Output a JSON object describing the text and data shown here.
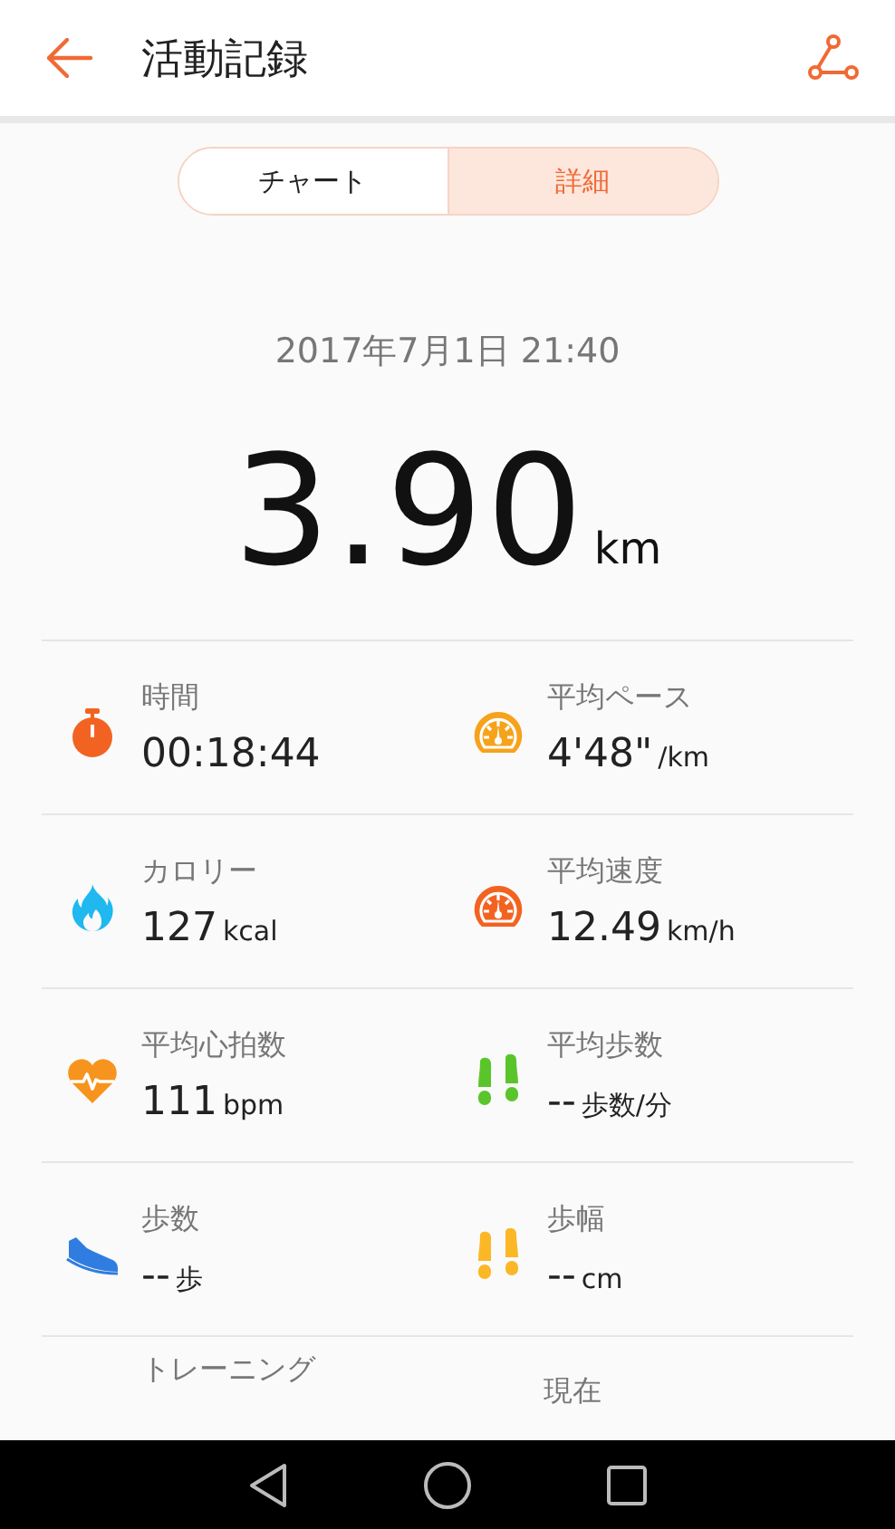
{
  "header": {
    "title": "活動記録"
  },
  "tabs": [
    {
      "label": "チャート",
      "selected": false
    },
    {
      "label": "詳細",
      "selected": true
    }
  ],
  "date": "2017年7月1日 21:40",
  "distance": {
    "value": "3.90",
    "unit": "km"
  },
  "metrics": [
    {
      "kind": "timer",
      "color": "#f26322",
      "label": "時間",
      "value": "00:18:44"
    },
    {
      "kind": "gauge",
      "color": "#f7a21b",
      "label": "平均ペース",
      "value": "4'48\"",
      "unit": "/km"
    },
    {
      "kind": "flame",
      "color": "#1fb8ef",
      "label": "カロリー",
      "value": "127",
      "unit": "kcal"
    },
    {
      "kind": "gauge",
      "color": "#f26322",
      "label": "平均速度",
      "value": "12.49",
      "unit": "km/h"
    },
    {
      "kind": "heart",
      "color": "#f7941d",
      "label": "平均心拍数",
      "value": "111",
      "unit": "bpm"
    },
    {
      "kind": "footprints",
      "color": "#5ac52a",
      "label": "平均歩数",
      "value": "--",
      "unit": "歩数/分"
    },
    {
      "kind": "shoe",
      "color": "#2f7de1",
      "label": "歩数",
      "value": "--",
      "unit": "歩"
    },
    {
      "kind": "footprints",
      "color": "#fbb726",
      "label": "歩幅",
      "value": "--",
      "unit": "cm"
    }
  ],
  "partial_row": [
    "トレーニング",
    "現在"
  ]
}
